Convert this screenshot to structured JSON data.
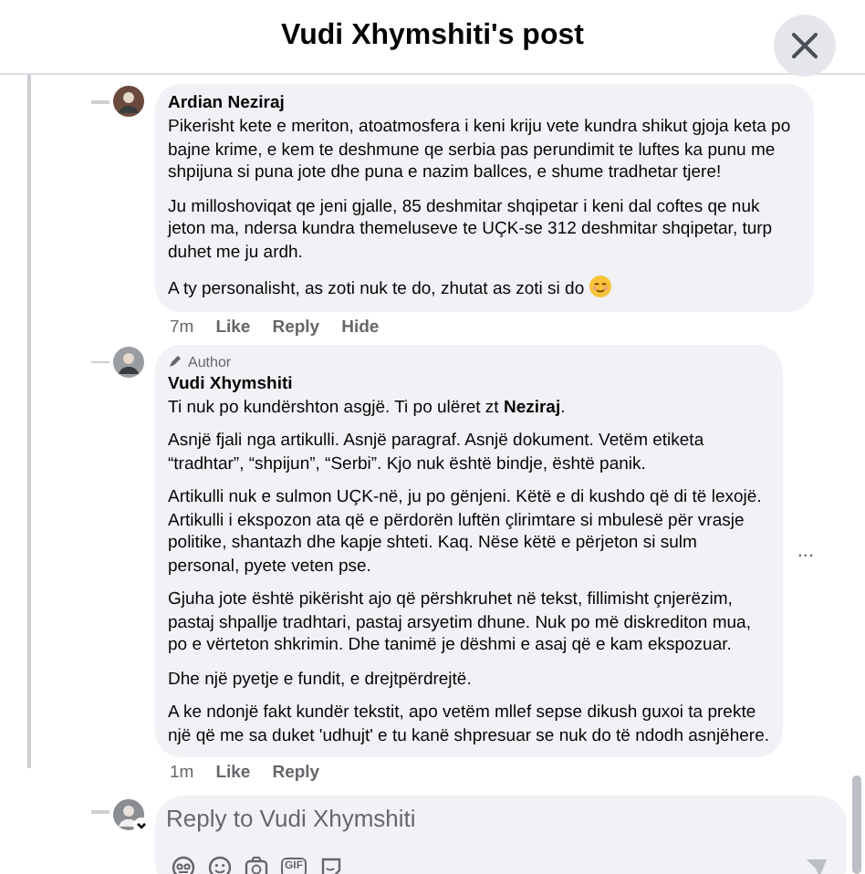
{
  "window": {
    "title": "Vudi Xhymshiti's post"
  },
  "comments": [
    {
      "author": "Ardian Neziraj",
      "paragraphs": [
        "Pikerisht kete e meriton, atoatmosfera i keni kriju vete kundra shikut gjoja keta po bajne krime, e kem te deshmune qe serbia pas perundimit te luftes ka punu me shpijuna si puna jote dhe puna e nazim ballces, e shume tradhetar tjere!",
        "Ju milloshoviqat qe jeni gjalle, 85 deshmitar shqipetar i keni dal coftes qe nuk jeton ma, ndersa kundra themeluseve te UÇK-se 312 deshmitar shqipetar, turp duhet me ju ardh.",
        "A ty personalisht, as zoti nuk te do, zhutat as zoti si do"
      ],
      "ends_with_emoji": true,
      "time": "7m",
      "actions": [
        "Like",
        "Reply",
        "Hide"
      ]
    },
    {
      "author": "Vudi Xhymshiti",
      "badge": "Author",
      "paragraphs": [
        "Ti nuk po kundërshton asgjë. Ti po ulëret zt **Neziraj**.",
        "Asnjë fjali nga artikulli. Asnjë paragraf. Asnjë dokument. Vetëm etiketa “tradhtar”, “shpijun”, “Serbi”. Kjo nuk është bindje, është panik.",
        "Artikulli nuk e sulmon UÇK-në, ju po gënjeni. Këtë e di kushdo që di të lexojë. Artikulli i ekspozon ata që e përdorën luftën çlirimtare si mbulesë për vrasje politike, shantazh dhe kapje shteti. Kaq. Nëse këtë e përjeton si sulm personal, pyete veten pse.",
        "Gjuha jote është pikërisht ajo që përshkruhet në tekst, fillimisht çnjerëzim, pastaj shpallje tradhtari, pastaj arsyetim dhune. Nuk po më diskrediton mua, po e vërteton shkrimin. Dhe tanimë je dëshmi e asaj që e kam ekspozuar.",
        "Dhe një pyetje e fundit, e drejtpërdrejtë.",
        "A ke ndonjë fakt kundër tekstit, apo vetëm mllef sepse dikush guxoi ta prekte një që me sa duket 'udhujt' e tu kanë shpresuar se nuk do të ndodh asnjëhere."
      ],
      "ends_with_emoji": false,
      "more": "...",
      "time": "1m",
      "actions": [
        "Like",
        "Reply"
      ]
    }
  ],
  "reply_box": {
    "placeholder": "Reply to Vudi Xhymshiti",
    "gif_label": "GIF"
  }
}
